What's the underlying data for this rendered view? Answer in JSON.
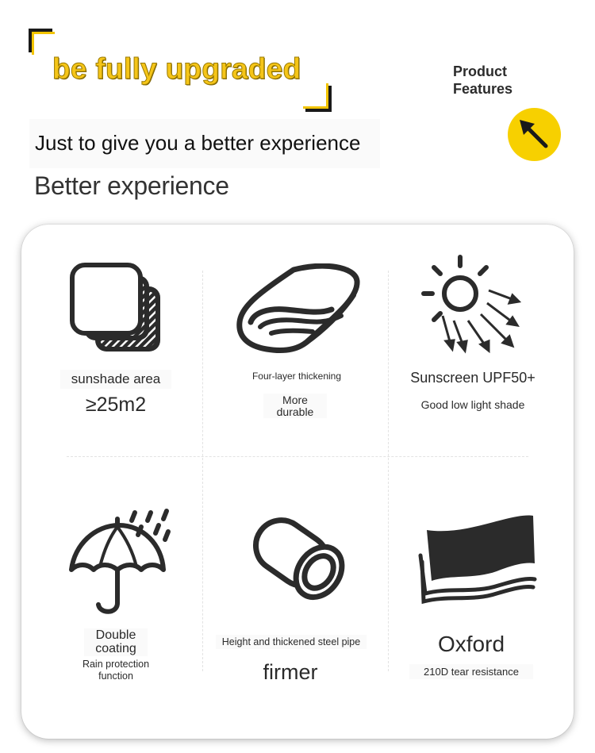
{
  "header": {
    "headline": "be fully upgraded",
    "subline": "Just to give you a better experience",
    "tagline": "Better experience",
    "pf_line1": "Product",
    "pf_line2": "Features"
  },
  "features": [
    {
      "icon": "layers-icon",
      "title": "sunshade area",
      "value": "≥25m2"
    },
    {
      "icon": "blanket-icon",
      "title": "Four-layer thickening",
      "value_line1": "More",
      "value_line2": "durable"
    },
    {
      "icon": "sun-icon",
      "title": "Sunscreen UPF50+",
      "value": "Good low light shade"
    },
    {
      "icon": "umbrella-icon",
      "title_line1": "Double",
      "title_line2": "coating",
      "value_line1": "Rain protection",
      "value_line2": "function"
    },
    {
      "icon": "pipe-icon",
      "title": "Height and thickened steel pipe",
      "value": "firmer"
    },
    {
      "icon": "fabric-icon",
      "title": "Oxford",
      "value": "210D tear resistance"
    }
  ],
  "colors": {
    "accent": "#f5c518",
    "badge": "#f7d000",
    "ink": "#2b2b2b"
  }
}
